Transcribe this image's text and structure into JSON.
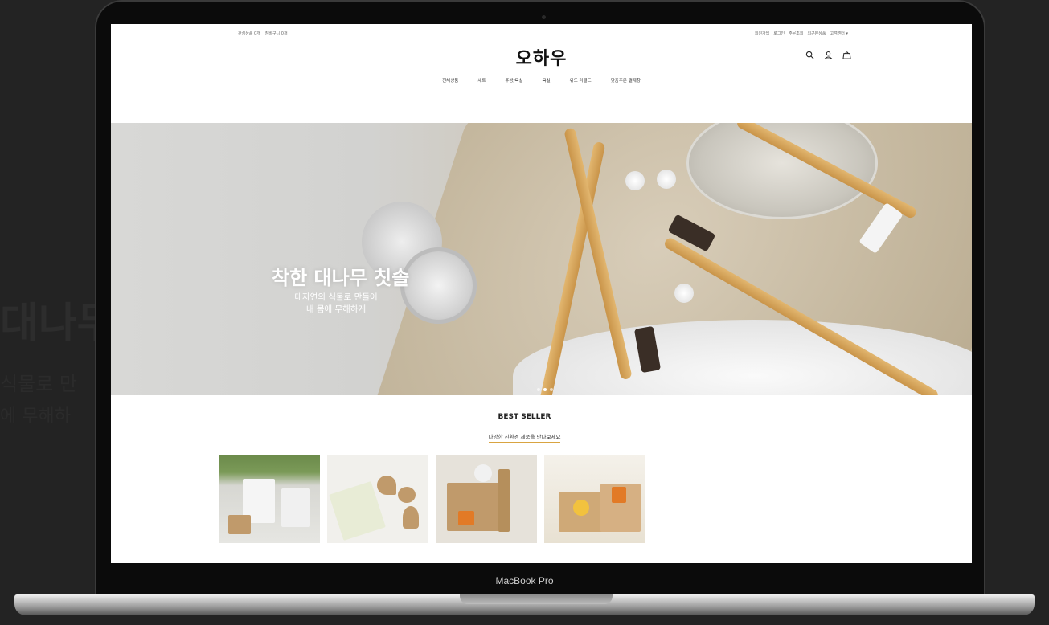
{
  "site": {
    "logo": "오하우",
    "topbar_left": [
      "관심상품 0개",
      "장바구니 0개"
    ],
    "topbar_right": [
      "회원가입",
      "로그인",
      "주문조회",
      "최근본상품",
      "고객센터 ▾"
    ],
    "icons": [
      "search-icon",
      "user-icon",
      "bag-icon"
    ]
  },
  "nav": [
    "전체상품",
    "세트",
    "주방/욕실",
    "욕실",
    "위드 러블드",
    "맞춤주문 결제창"
  ],
  "hero": {
    "title": "착한 대나무 칫솔",
    "subtitle_line1": "대자연의 식물로 만들어",
    "subtitle_line2": "내 몸에 무해하게"
  },
  "best_seller": {
    "title": "BEST SELLER",
    "subtitle": "다양한 친환경 제품을 만나보세요"
  },
  "device": {
    "label": "MacBook Pro"
  },
  "colors": {
    "accent": "#d9a441",
    "bamboo": "#d2a35c"
  }
}
